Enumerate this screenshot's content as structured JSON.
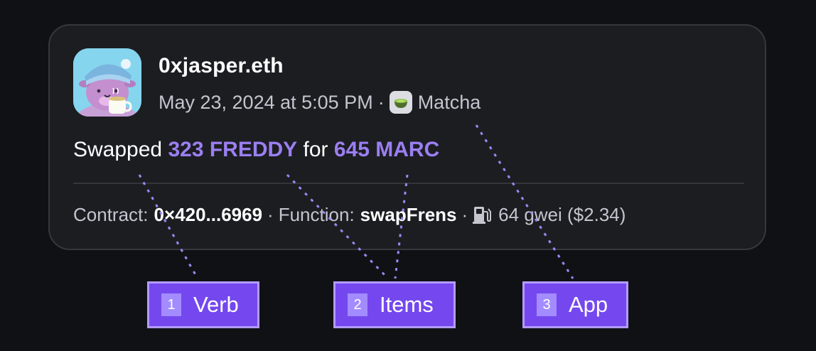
{
  "event": {
    "username": "0xjasper.eth",
    "timestamp": "May 23, 2024 at 5:05 PM",
    "separator": "·",
    "app_name": "Matcha",
    "app_icon": "matcha-bowl-icon",
    "avatar": "cartoon-creature-avatar"
  },
  "headline": {
    "verb": "Swapped",
    "item_sent": "323 FREDDY",
    "connector": "for",
    "item_received": "645 MARC"
  },
  "details": {
    "contract_label": "Contract:",
    "contract_value": "0×420...6969",
    "function_label": "Function:",
    "function_value": "swapFrens",
    "gas_icon": "fuel-pump-icon",
    "gas_value": "64 gwei ($2.34)"
  },
  "annotations": [
    {
      "number": "1",
      "label": "Verb"
    },
    {
      "number": "2",
      "label": "Items"
    },
    {
      "number": "3",
      "label": "App"
    }
  ],
  "colors": {
    "background": "#101115",
    "card": "#1c1d21",
    "card_border": "#35373d",
    "highlight": "#9b7ff2",
    "annotation_fill": "#7448ee",
    "annotation_border": "#b39bff",
    "leader_line": "#9f86f5"
  }
}
